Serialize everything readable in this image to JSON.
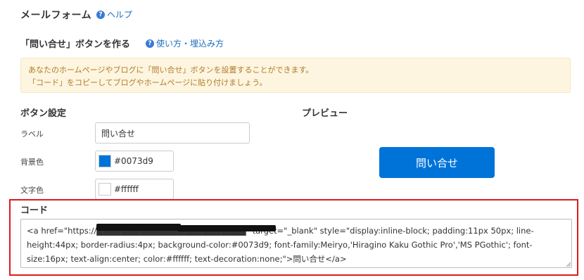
{
  "header": {
    "title": "メールフォーム",
    "help_label": "ヘルプ"
  },
  "section": {
    "title": "「問い合せ」ボタンを作る",
    "usage_link": "使い方・埋込み方"
  },
  "notice": {
    "line1": "あなたのホームページやブログに「問い合せ」ボタンを設置することができます。",
    "line2": "「コード」をコピーしてブログやホームページに貼り付けましょう。"
  },
  "settings": {
    "heading": "ボタン設定",
    "label_field": {
      "label": "ラベル",
      "value": "問い合せ"
    },
    "bg_color_field": {
      "label": "背景色",
      "value": "#0073d9",
      "color": "#0073d9"
    },
    "text_color_field": {
      "label": "文字色",
      "value": "#ffffff",
      "color": "#ffffff"
    }
  },
  "preview": {
    "heading": "プレビュー",
    "button_label": "問い合せ",
    "button_bg": "#0073d9",
    "button_fg": "#ffffff"
  },
  "code": {
    "heading": "コード",
    "snippet": "<a href=\"https://████████████████████████\" target=\"_blank\" style=\"display:inline-block; padding:11px 50px; line-height:44px; border-radius:4px; background-color:#0073d9; font-family:Meiryo,'Hiragino Kaku Gothic Pro','MS PGothic'; font-size:16px; text-align:center; color:#ffffff; text-decoration:none;\">問い合せ</a>"
  },
  "colors": {
    "accent": "#0073d9",
    "link": "#1a6dbf",
    "highlight": "#dd1c1c",
    "notice_bg": "#fdf5df",
    "notice_text": "#b07c2d"
  }
}
